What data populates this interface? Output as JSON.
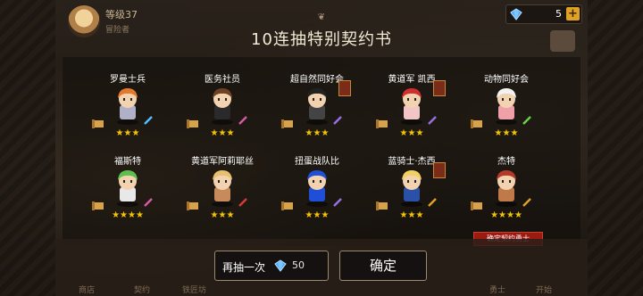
{
  "player": {
    "name": "等级37",
    "sub": "冒险者"
  },
  "currency": {
    "gems": "5",
    "plus": "+"
  },
  "dialog": {
    "ornament": "❦",
    "title": "10连抽特别契约书",
    "heroes": [
      {
        "name": "罗曼士兵",
        "stars": "★★★",
        "hair": "#e27a2d",
        "body": "#b0b0c8",
        "weapon_color": "#4fc1ff",
        "banner": false
      },
      {
        "name": "医务社员",
        "stars": "★★★",
        "hair": "#6e4124",
        "body": "#2a2a2a",
        "weapon_color": "#d65aa6",
        "banner": false
      },
      {
        "name": "超自然同好会",
        "stars": "★★★",
        "hair": "#222222",
        "body": "#444444",
        "weapon_color": "#9a6fe0",
        "banner": true
      },
      {
        "name": "黄道军 凯西",
        "stars": "★★★",
        "hair": "#d03030",
        "body": "#f2c6c6",
        "weapon_color": "#9a6fe0",
        "banner": true
      },
      {
        "name": "动物同好会",
        "stars": "★★★",
        "hair": "#f2f2f2",
        "body": "#f0a0a8",
        "weapon_color": "#6bd14a",
        "banner": false
      },
      {
        "name": "福斯特",
        "stars": "★★★★",
        "hair": "#5fbf4e",
        "body": "#e8e8e8",
        "weapon_color": "#d65aa6",
        "banner": false
      },
      {
        "name": "黄道军阿莉耶丝",
        "stars": "★★★",
        "hair": "#e6c070",
        "body": "#c78a5a",
        "weapon_color": "#d63a3a",
        "banner": false
      },
      {
        "name": "扭蛋战队比",
        "stars": "★★★",
        "hair": "#1f4fd6",
        "body": "#1f4fd6",
        "weapon_color": "#9a6fe0",
        "banner": false
      },
      {
        "name": "蓝骑士·杰西",
        "stars": "★★★",
        "hair": "#f0d060",
        "body": "#2a50a8",
        "weapon_color": "#e0a225",
        "banner": true
      },
      {
        "name": "杰特",
        "stars": "★★★★",
        "hair": "#b23a2a",
        "body": "#c07a4a",
        "weapon_color": "#e0a225",
        "banner": false
      }
    ],
    "confirm_tag": "确定契约勇士",
    "redraw_label": "再抽一次",
    "redraw_cost": "50",
    "confirm_label": "确定"
  },
  "bottom_nav": [
    "商店",
    "契约",
    "铁匠坊",
    "",
    "",
    "勇士",
    "开始"
  ],
  "colors": {
    "gem": "#4aa8ff",
    "star": "#f5c400",
    "accent": "#e0a225"
  }
}
